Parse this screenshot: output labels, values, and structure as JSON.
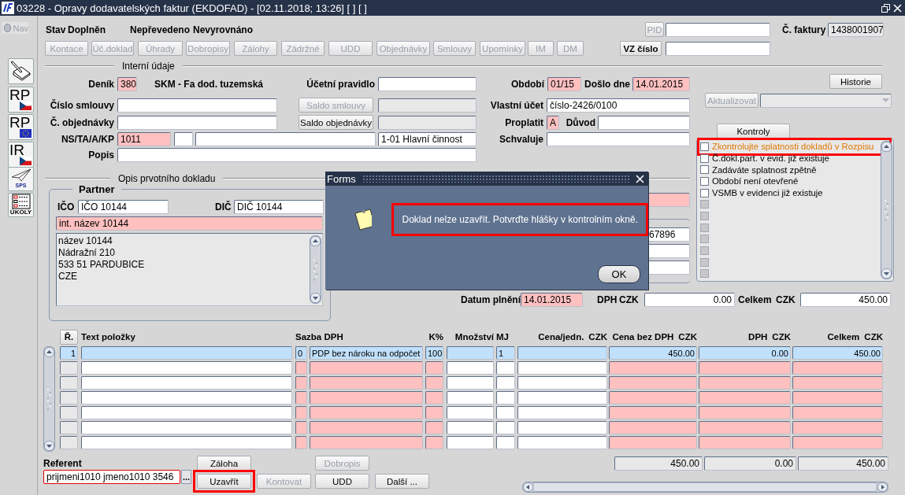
{
  "window": {
    "title": "03228 - Opravy dodavatelských faktur (EKDOFAD) - [02.11.2018; 13:26] [ ] [ ]"
  },
  "toolbar": {
    "nav": {
      "label": "Nav",
      "disabled": true
    },
    "tools": [
      {
        "kind": "pen"
      },
      {
        "kind": "flag-cz",
        "label": "RP"
      },
      {
        "kind": "flag-eu",
        "label": "RP"
      },
      {
        "kind": "flag-cz",
        "label": "IR"
      },
      {
        "kind": "plane",
        "label": "SPS"
      },
      {
        "kind": "tasks",
        "label": "ÚKOLY"
      }
    ]
  },
  "status": {
    "label": "Stav",
    "value": "Doplněn",
    "transfer": "Nepřevedeno",
    "settlement": "Nevyrovnáno"
  },
  "pid": {
    "button": "PID",
    "disabled": true
  },
  "invoice_number": {
    "label": "Č. faktury",
    "value": "1438001907",
    "readonly": true
  },
  "nav_buttons": [
    {
      "label": "Kontace",
      "disabled": true
    },
    {
      "label": "Úč.doklad",
      "disabled": true
    },
    {
      "label": "Úhrady",
      "disabled": true
    },
    {
      "label": "Dobropisy",
      "disabled": true
    },
    {
      "label": "Zálohy",
      "disabled": true
    },
    {
      "label": "Zádržné",
      "disabled": true
    },
    {
      "label": "UDD",
      "disabled": true
    },
    {
      "label": "Objednávky",
      "disabled": true
    },
    {
      "label": "Smlouvy",
      "disabled": true
    },
    {
      "label": "Upomínky",
      "disabled": true
    },
    {
      "label": "IM",
      "disabled": true
    },
    {
      "label": "DM",
      "disabled": true
    }
  ],
  "vz": {
    "button": "VZ číslo",
    "disabled": false
  },
  "internal": {
    "title": "Interní údaje",
    "journal": {
      "label": "Deník",
      "value": "380",
      "required": true,
      "name": "SKM - Fa dod. tuzemská"
    },
    "accounting_rule": {
      "label": "Účetní pravidlo"
    },
    "contract": {
      "label": "Číslo smlouvy",
      "button": "Saldo smlouvy",
      "button_disabled": true,
      "balance_readonly": true
    },
    "order": {
      "label": "Č. objednávky",
      "button": "Saldo objednávky",
      "button_disabled": false,
      "balance_readonly": true
    },
    "cost_center": {
      "label": "NS/TA/A/KP",
      "fields": [
        {
          "value": "1011",
          "required": true
        },
        {
          "required": false
        },
        {
          "required": false
        },
        {
          "value": "1-01 Hlavní činnost",
          "required": false
        }
      ]
    },
    "description": {
      "label": "Popis"
    },
    "period": {
      "label": "Období",
      "value": "01/15",
      "required": true
    },
    "received": {
      "label": "Došlo dne",
      "value": "14.01.2015",
      "required": true
    },
    "own_account": {
      "label": "Vlastní účet",
      "value": "číslo-2426/0100"
    },
    "pay": {
      "label": "Proplatit",
      "value": "A",
      "required": true
    },
    "reason": {
      "label": "Důvod"
    },
    "approver": {
      "label": "Schvaluje"
    }
  },
  "history": {
    "button": "Historie"
  },
  "update": {
    "button": "Aktualizovat",
    "disabled": true
  },
  "checks": {
    "tab": "Kontroly",
    "items": [
      {
        "text": "Zkontrolujte splatnosti dokladů v Rozpisu",
        "checked": false,
        "disabled": false,
        "warning": true,
        "highlighted": true
      },
      {
        "text": "Č.dokl.part. v evid. již existuje",
        "checked": false,
        "disabled": false,
        "warning": false,
        "highlighted": false
      },
      {
        "text": "Zadáváte splatnost zpětně",
        "checked": false,
        "disabled": false,
        "warning": false,
        "highlighted": false
      },
      {
        "text": "Období není otevřené",
        "checked": false,
        "disabled": false,
        "warning": false,
        "highlighted": false
      },
      {
        "text": "VSMB v evidenci již existuje",
        "checked": false,
        "disabled": false,
        "warning": false,
        "highlighted": false
      },
      {
        "checked": false,
        "disabled": true,
        "warning": false,
        "highlighted": false
      },
      {
        "checked": false,
        "disabled": true,
        "warning": false,
        "highlighted": false
      },
      {
        "checked": false,
        "disabled": true,
        "warning": false,
        "highlighted": false
      },
      {
        "checked": false,
        "disabled": true,
        "warning": false,
        "highlighted": false
      },
      {
        "checked": false,
        "disabled": true,
        "warning": false,
        "highlighted": false
      },
      {
        "checked": false,
        "disabled": true,
        "warning": false,
        "highlighted": false
      },
      {
        "checked": false,
        "disabled": true,
        "warning": false,
        "highlighted": false
      }
    ]
  },
  "source": {
    "title": "Opis prvotního dokladu",
    "partner": {
      "title": "Partner",
      "ico_label": "IČO",
      "ico": "IČO 10144",
      "dic_label": "DIČ",
      "dic": "DIČ 10144",
      "internal_name": "int. název 10144",
      "address": [
        "název 10144",
        "Nádražní 210",
        "533 51 PARDUBICE",
        "CZE"
      ]
    },
    "account_fragment": "67896"
  },
  "summary": {
    "date_label": "Datum plnění",
    "date": "14.01.2015",
    "vat_label": "DPH",
    "vat_currency": "CZK",
    "vat": "0.00",
    "total_label": "Celkem",
    "total_currency": "CZK",
    "total": "450.00"
  },
  "table": {
    "columns": [
      {
        "label": "Ř.",
        "required": false
      },
      {
        "label": "Text položky",
        "required": false
      },
      {
        "label": "Sazba DPH",
        "required": true
      },
      {
        "label": "K%",
        "required": true
      },
      {
        "label": "Množství",
        "required": false
      },
      {
        "label": "MJ",
        "required": false
      },
      {
        "label": "Cena/jedn.",
        "currency": "CZK",
        "required": false
      },
      {
        "label": "Cena bez DPH",
        "currency": "CZK",
        "required": true
      },
      {
        "label": "DPH",
        "currency": "CZK",
        "required": true
      },
      {
        "label": "Celkem",
        "currency": "CZK",
        "required": true
      }
    ],
    "rows": [
      {
        "selected": true,
        "cells": [
          [
            "1"
          ],
          [],
          [
            "0",
            "PDP bez nároku na odpočet"
          ],
          [
            "100"
          ],
          [],
          [
            "1"
          ],
          [],
          [
            "450.00"
          ],
          [
            "0.00"
          ],
          [
            "450.00"
          ]
        ]
      },
      {
        "selected": false
      },
      {
        "selected": false
      },
      {
        "selected": false
      },
      {
        "selected": false
      },
      {
        "selected": false
      },
      {
        "selected": false
      }
    ],
    "totals": [
      "450.00",
      "0.00",
      "450.00"
    ]
  },
  "referent": {
    "label": "Referent",
    "value": "prijmeni1010 jmeno1010 3546",
    "lookup": "..."
  },
  "actions": [
    {
      "label": "Záloha",
      "disabled": false,
      "highlighted": false
    },
    {
      "label": "Dobropis",
      "disabled": true,
      "highlighted": false
    },
    {
      "label": "Uzavřít",
      "disabled": false,
      "highlighted": true
    },
    {
      "label": "Kontovat",
      "disabled": true,
      "highlighted": false
    },
    {
      "label": "UDD",
      "disabled": false,
      "highlighted": false
    },
    {
      "label": "Další ...",
      "disabled": false,
      "highlighted": false
    }
  ],
  "dialog": {
    "title": "Forms",
    "message": "Doklad nelze uzavřít. Potvrďte hlášky v kontrolním okně.",
    "highlighted": true,
    "button": "OK"
  }
}
